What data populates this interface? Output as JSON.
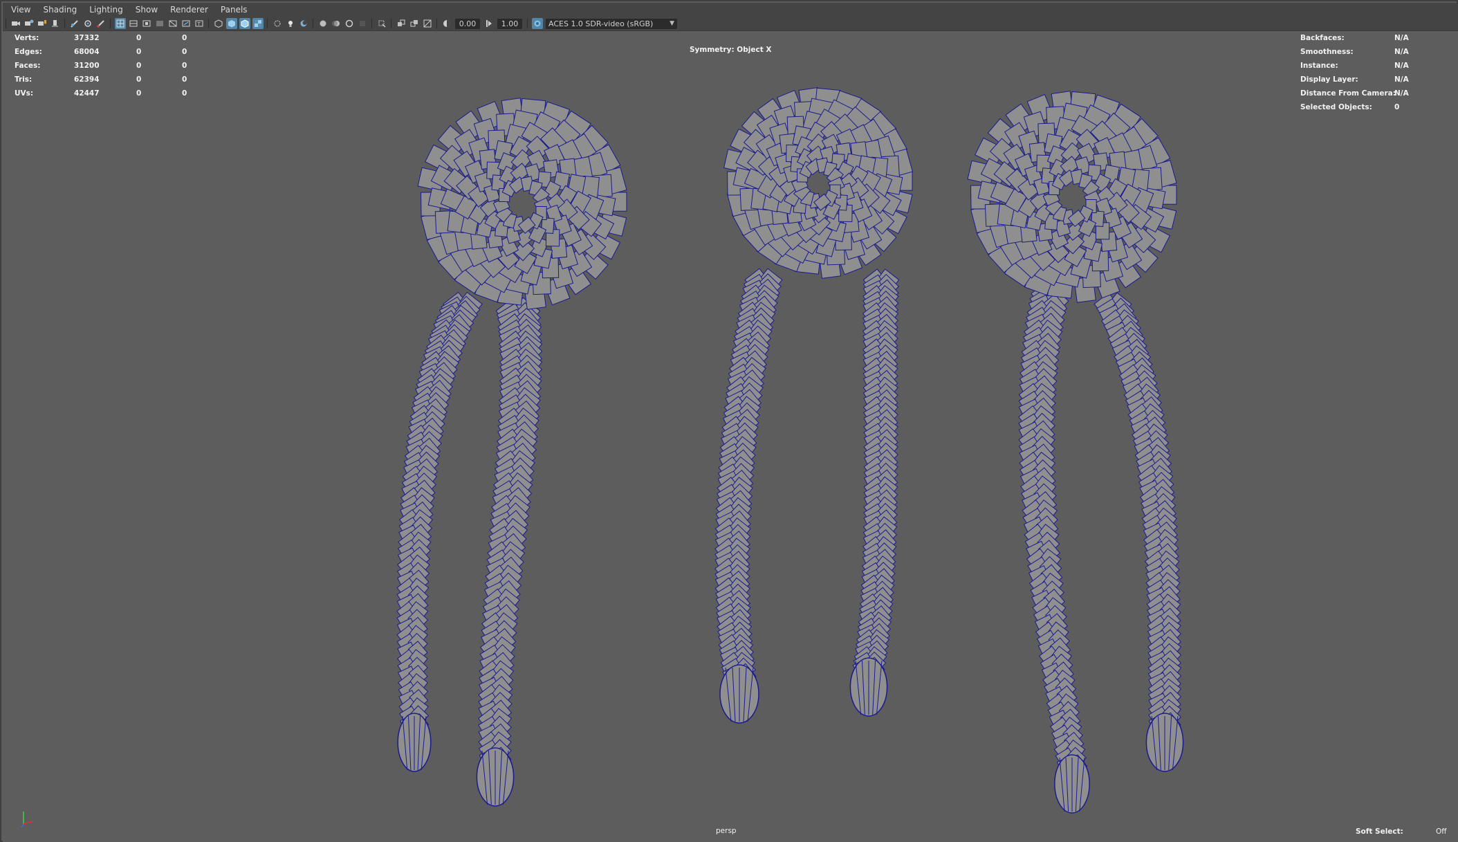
{
  "menubar": {
    "items": [
      "View",
      "Shading",
      "Lighting",
      "Show",
      "Renderer",
      "Panels"
    ]
  },
  "toolbar": {
    "icons": [
      "camera-icon",
      "camera-attributes-icon",
      "bookmark-icon",
      "image-plane-icon",
      "grease-pencil-icon",
      "isolate-select-icon",
      "pivot-icon",
      "brush-icon",
      "wireframe-icon",
      "smooth-shade-icon",
      "smooth-shade-all-icon",
      "textured-icon",
      "use-lights-icon",
      "shadows-icon",
      "ambient-occlusion-icon",
      "motion-blur-icon",
      "anti-aliasing-icon",
      "xray-icon",
      "xray-joints-icon",
      "xray-components-icon",
      "backface-icon",
      "light-icon",
      "camera-gate-icon",
      "grid-icon",
      "resolution-gate-icon",
      "exposure-icon",
      "gamma-icon",
      "color-management-icon"
    ],
    "exposure": "0.00",
    "gamma": "1.00",
    "color_space": "ACES 1.0 SDR-video (sRGB)"
  },
  "hud_left": {
    "rows": [
      {
        "label": "Verts:",
        "v1": "37332",
        "v2": "0",
        "v3": "0"
      },
      {
        "label": "Edges:",
        "v1": "68004",
        "v2": "0",
        "v3": "0"
      },
      {
        "label": "Faces:",
        "v1": "31200",
        "v2": "0",
        "v3": "0"
      },
      {
        "label": "Tris:",
        "v1": "62394",
        "v2": "0",
        "v3": "0"
      },
      {
        "label": "UVs:",
        "v1": "42447",
        "v2": "0",
        "v3": "0"
      }
    ]
  },
  "hud_center": {
    "symmetry": "Symmetry: Object X"
  },
  "hud_right": {
    "rows": [
      {
        "label": "Backfaces:",
        "value": "N/A"
      },
      {
        "label": "Smoothness:",
        "value": "N/A"
      },
      {
        "label": "Instance:",
        "value": "N/A"
      },
      {
        "label": "Display Layer:",
        "value": "N/A"
      },
      {
        "label": "Distance From Camera:",
        "value": "N/A"
      },
      {
        "label": "Selected Objects:",
        "value": "0"
      }
    ]
  },
  "camera_label": "persp",
  "soft_select": {
    "label": "Soft Select:",
    "value": "Off"
  },
  "colors": {
    "viewport_bg": "#5d5d5d",
    "wireframe": "#1a1a8f",
    "mesh_fill": "#8f8f8f",
    "active_button": "#5285a6"
  }
}
